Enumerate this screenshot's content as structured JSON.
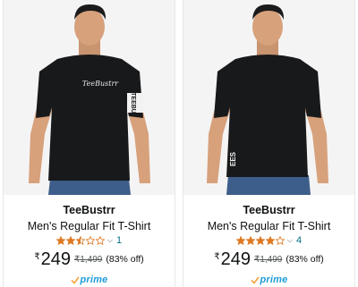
{
  "products": [
    {
      "brand": "TeeBustrr",
      "title": "Men's Regular Fit T-Shirt",
      "rating": 2.5,
      "rating_count": "1",
      "currency": "₹",
      "price": "249",
      "mrp": "₹1,499",
      "discount": "(83% off)",
      "prime_label": "prime",
      "print_text": "TeeBustrr",
      "sleeve_text": "TEEBU"
    },
    {
      "brand": "TeeBustrr",
      "title": "Men's Regular Fit T-Shirt",
      "rating": 4.0,
      "rating_count": "4",
      "currency": "₹",
      "price": "249",
      "mrp": "₹1,499",
      "discount": "(83% off)",
      "prime_label": "prime",
      "print_text": "",
      "sleeve_text": "EES"
    }
  ],
  "colors": {
    "star": "#de7921",
    "star_empty": "#ffffff",
    "link": "#007185",
    "prime": "#1f9cd8",
    "shirt": "#18191b",
    "skin": "#d7a17c",
    "jeans": "#3d5e8a",
    "background": "#f4f4f4"
  },
  "icons": {
    "star": "star-icon",
    "chevron": "chevron-down-icon",
    "prime_check": "prime-check-icon"
  }
}
